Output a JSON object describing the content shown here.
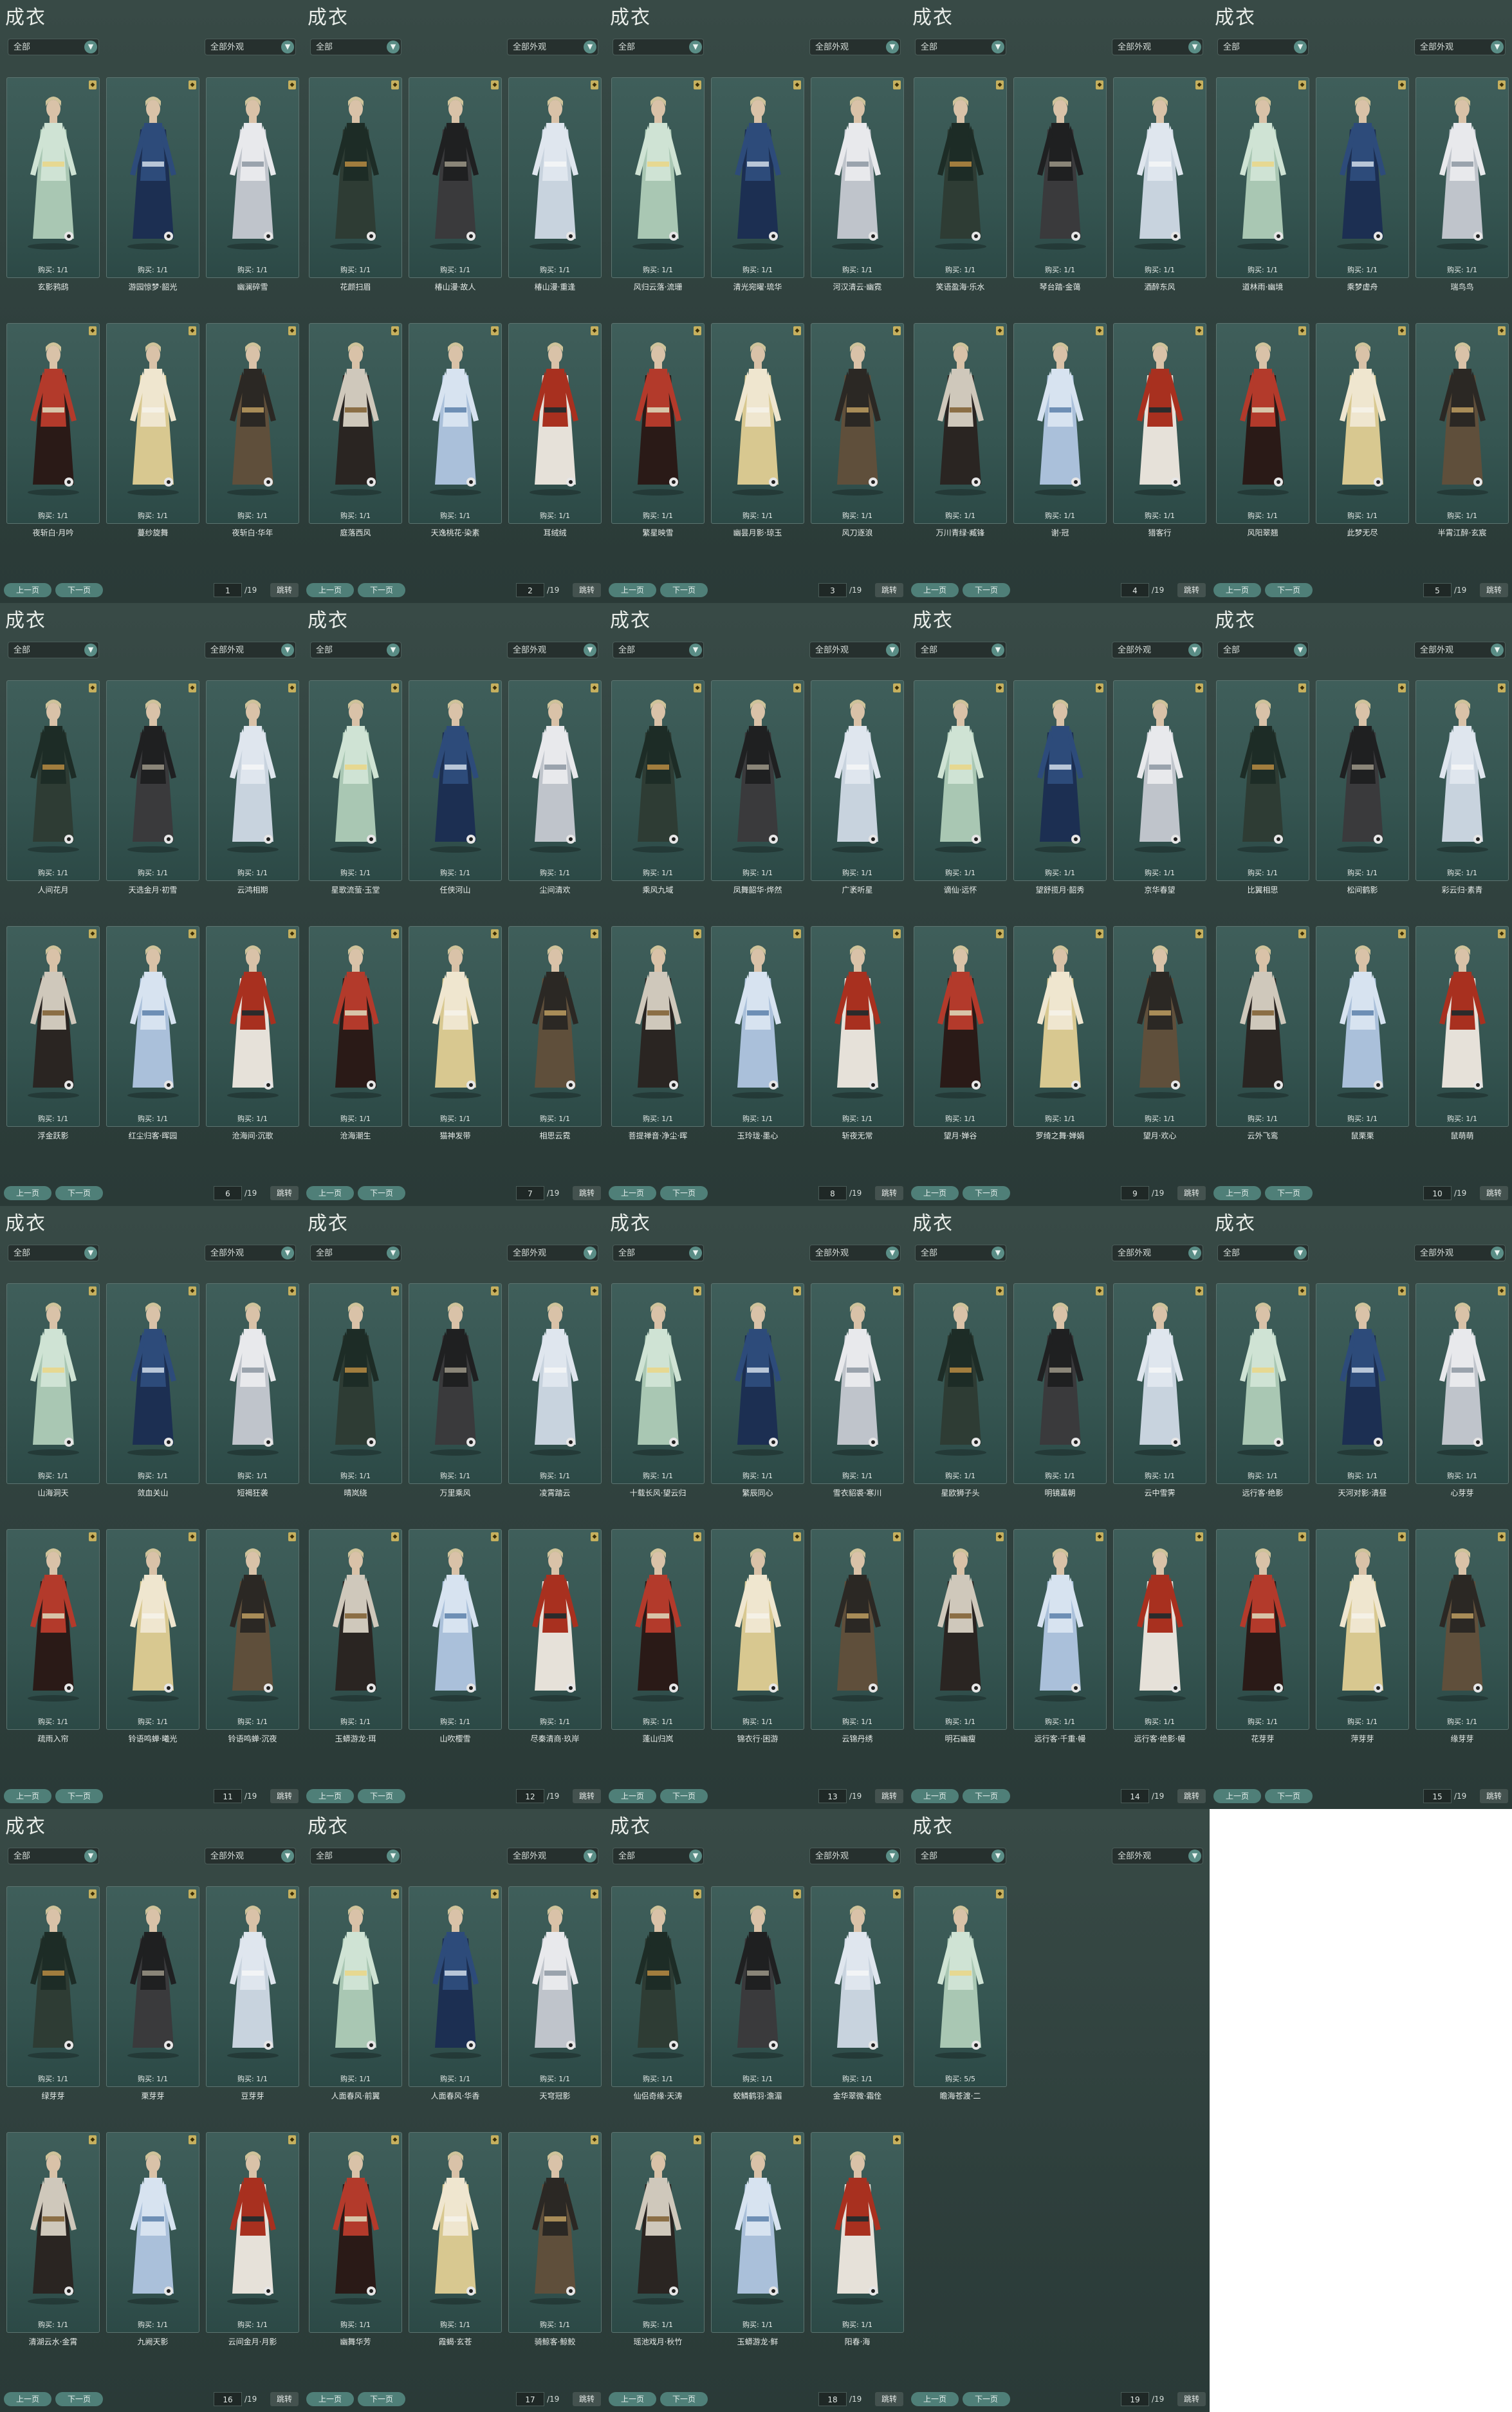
{
  "ui": {
    "title": "成衣",
    "filter1": "全部",
    "filter2": "全部外观",
    "purchase": "购买: 1/1",
    "purchase_alt": "购买: 5/5",
    "prev": "上一页",
    "next": "下一页",
    "jump": "跳转",
    "total": "/19",
    "dropdown_icon": "chevron-down"
  },
  "colors": {
    "panel_bg": "#2f403d",
    "card_bg": "#3f5e5a",
    "accent": "#5a8d86",
    "lock": "#c6b05e"
  },
  "panels": [
    {
      "page": "1",
      "items": [
        "玄影鸦鸱",
        "游园惊梦·韶光",
        "幽澜碎雪",
        "夜斩白·月吟",
        "蔓纱旋舞",
        "夜斩白·华年"
      ]
    },
    {
      "page": "2",
      "items": [
        "花颜扫眉",
        "椿山漫·故人",
        "椿山漫·重逢",
        "庭落西风",
        "天逸桃花·染素",
        "耳绒绒"
      ]
    },
    {
      "page": "3",
      "items": [
        "风归云落·流珊",
        "清光宛曜·琉华",
        "河汉清云·幽霓",
        "繁星映雪",
        "幽昙月影·琼玉",
        "风刀逐浪"
      ]
    },
    {
      "page": "4",
      "items": [
        "笑语盈海·乐水",
        "琴台踏·金蔼",
        "酒醉东风",
        "万川青绿·臧锋",
        "谢·冠",
        "猎客行"
      ]
    },
    {
      "page": "5",
      "items": [
        "道林雨·幽境",
        "乘梦虚舟",
        "瑞鸟鸟",
        "风阳翠翘",
        "此梦无尽",
        "半霄江醉·玄宸"
      ]
    },
    {
      "page": "6",
      "items": [
        "人间花月",
        "天选金月·初雪",
        "云鸿相期",
        "浮金跃影",
        "红尘归客·晖园",
        "沧海间·沉歌"
      ]
    },
    {
      "page": "7",
      "items": [
        "星歌流萤·玉堂",
        "任侠河山",
        "尘间清欢",
        "沧海潮生",
        "猫神发带",
        "相思云霓"
      ]
    },
    {
      "page": "8",
      "items": [
        "乘风九域",
        "凤舞韶华·烨然",
        "广袤听星",
        "菩提禅音·净尘·晖",
        "玉玲珑·墨心",
        "斩夜无常"
      ]
    },
    {
      "page": "9",
      "items": [
        "谪仙·远怀",
        "望舒揽月·韶秀",
        "京华春望",
        "望月·婵谷",
        "罗绮之舞·婵娟",
        "望月·欢心"
      ]
    },
    {
      "page": "10",
      "items": [
        "比翼相思",
        "松间鹤影",
        "彩云归·素青",
        "云外飞鸾",
        "鼠栗栗",
        "鼠萌萌"
      ]
    },
    {
      "page": "11",
      "items": [
        "山海洞天",
        "敛血关山",
        "短褐狂袭",
        "疏雨入帘",
        "铃语鸣蝉·曦光",
        "铃语鸣蝉·沉夜"
      ]
    },
    {
      "page": "12",
      "items": [
        "晴岚绕",
        "万里乘风",
        "凌霄踏云",
        "玉蟒游龙·珥",
        "山吹樱雪",
        "尽秦清商·玖岸"
      ]
    },
    {
      "page": "13",
      "items": [
        "十载长风·望云归",
        "繁辰同心",
        "雪衣貂裘·寒川",
        "蓬山归岚",
        "锦衣行·困游",
        "云锦丹绣"
      ]
    },
    {
      "page": "14",
      "items": [
        "星欧狮子头",
        "明镜嘉朝",
        "云中雪霁",
        "明石幽瘦",
        "远行客·千重·幔",
        "远行客·绝影·幔"
      ]
    },
    {
      "page": "15",
      "items": [
        "远行客·绝影",
        "天河对影·清昼",
        "心芽芽",
        "花芽芽",
        "萍芽芽",
        "缘芽芽"
      ]
    },
    {
      "page": "16",
      "items": [
        "绿芽芽",
        "栗芽芽",
        "豆芽芽",
        "清湖云水·金霄",
        "九阙天影",
        "云间金月·月影"
      ]
    },
    {
      "page": "17",
      "items": [
        "人面春风·前翼",
        "人面春风·华香",
        "天穹冠影",
        "幽舞华芳",
        "霞蝎·玄苍",
        "骑鲸客·鲸鲛"
      ]
    },
    {
      "page": "18",
      "items": [
        "仙侣奇缘·天涛",
        "蛟鳞鹤羽·澹湄",
        "金华翠微·霜佺",
        "瑶池戏月·秋竹",
        "玉蟒游龙·鲜",
        "阳春·海"
      ]
    },
    {
      "page": "19",
      "items": [
        "瞻海苍渡·二"
      ]
    }
  ]
}
